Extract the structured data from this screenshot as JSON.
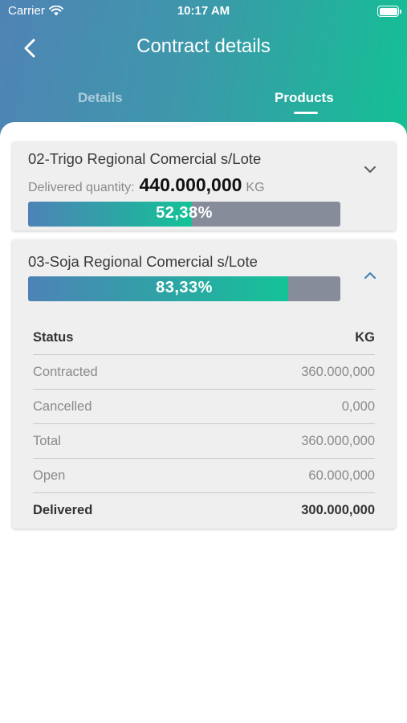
{
  "status_bar": {
    "carrier": "Carrier",
    "time": "10:17 AM"
  },
  "header": {
    "title": "Contract details"
  },
  "tabs": [
    {
      "label": "Details",
      "active": false
    },
    {
      "label": "Products",
      "active": true
    }
  ],
  "colors": {
    "accent": "#13c094",
    "gradient_start": "#4f84b5",
    "bar_track": "#878c9b"
  },
  "products": [
    {
      "name": "02-Trigo Regional Comercial s/Lote",
      "delivered_label": "Delivered quantity:",
      "delivered_value": "440.000,000",
      "unit": "KG",
      "progress_text": "52,38%",
      "progress": 0.5238,
      "expanded": false,
      "chevron_icon": "chevron-down-icon"
    },
    {
      "name": "03-Soja Regional Comercial s/Lote",
      "progress_text": "83,33%",
      "progress": 0.8333,
      "expanded": true,
      "chevron_icon": "chevron-up-icon",
      "table": {
        "header": {
          "status": "Status",
          "unit": "KG"
        },
        "rows": [
          {
            "label": "Contracted",
            "value": "360.000,000"
          },
          {
            "label": "Cancelled",
            "value": "0,000"
          },
          {
            "label": "Total",
            "value": "360.000,000"
          },
          {
            "label": "Open",
            "value": "60.000,000"
          },
          {
            "label": "Delivered",
            "value": "300.000,000"
          }
        ]
      }
    }
  ]
}
